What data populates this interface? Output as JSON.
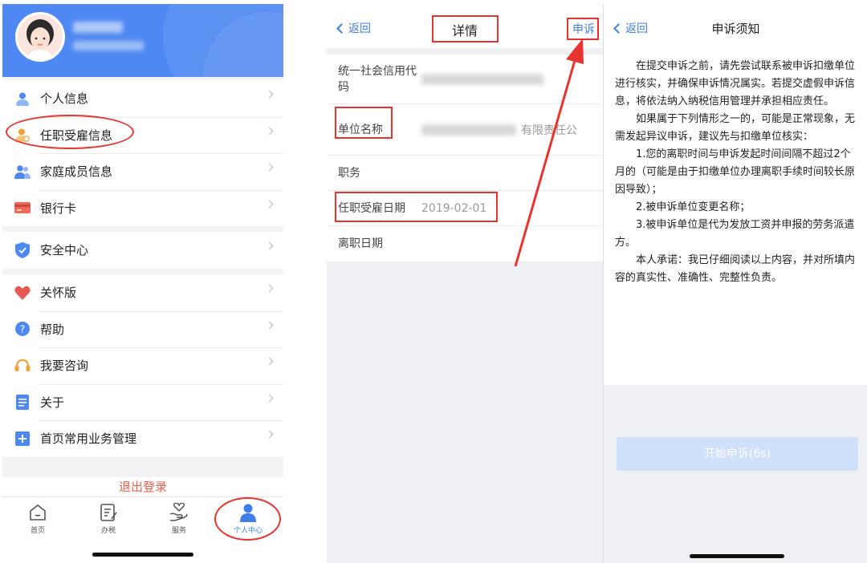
{
  "profile_panel": {
    "menu_group_1": [
      {
        "label": "个人信息",
        "icon": "person-icon"
      },
      {
        "label": "任职受雇信息",
        "icon": "employee-icon"
      },
      {
        "label": "家庭成员信息",
        "icon": "family-icon"
      },
      {
        "label": "银行卡",
        "icon": "bank-card-icon"
      }
    ],
    "menu_group_2": [
      {
        "label": "安全中心",
        "icon": "shield-icon"
      }
    ],
    "menu_group_3": [
      {
        "label": "关怀版",
        "icon": "heart-icon"
      },
      {
        "label": "帮助",
        "icon": "help-icon"
      },
      {
        "label": "我要咨询",
        "icon": "headset-icon"
      },
      {
        "label": "关于",
        "icon": "document-icon"
      },
      {
        "label": "首页常用业务管理",
        "icon": "plus-square-icon"
      }
    ],
    "logout_label": "退出登录",
    "tabs": [
      {
        "label": "首页",
        "icon": "home-icon"
      },
      {
        "label": "办税",
        "icon": "tax-icon"
      },
      {
        "label": "服务",
        "icon": "service-icon"
      },
      {
        "label": "个人中心",
        "icon": "user-center-icon"
      }
    ],
    "colors": {
      "header": "#4e88f2",
      "active_tab": "#3f7ee8",
      "logout": "#e8604d"
    }
  },
  "detail_panel": {
    "back_label": "返回",
    "title": "详情",
    "appeal_label": "申诉",
    "rows": {
      "credit_code_label": "统一社会信用代码",
      "unit_name_label": "单位名称",
      "unit_name_value_suffix": "有限责任公",
      "position_label": "职务",
      "hire_date_label": "任职受雇日期",
      "hire_date_value": "2019-02-01",
      "leave_date_label": "离职日期"
    }
  },
  "notice_panel": {
    "back_label": "返回",
    "title": "申诉须知",
    "paragraphs": [
      "在提交申诉之前，请先尝试联系被申诉扣缴单位进行核实，并确保申诉情况属实。若提交虚假申诉信息，将依法纳入纳税信用管理并承担相应责任。",
      "如果属于下列情形之一的，可能是正常现象，无需发起异议申诉，建议先与扣缴单位核实：",
      "1.您的离职时间与申诉发起时间间隔不超过2个月的（可能是由于扣缴单位办理离职手续时间较长原因导致）；",
      "2.被申诉单位变更名称；",
      "3.被申诉单位是代为发放工资并申报的劳务派遣方。",
      "本人承诺：我已仔细阅读以上内容，并对所填内容的真实性、准确性、完整性负责。"
    ],
    "start_button_label": "开始申诉(6s)"
  },
  "annotations": {
    "highlight_color": "#e8342e"
  }
}
